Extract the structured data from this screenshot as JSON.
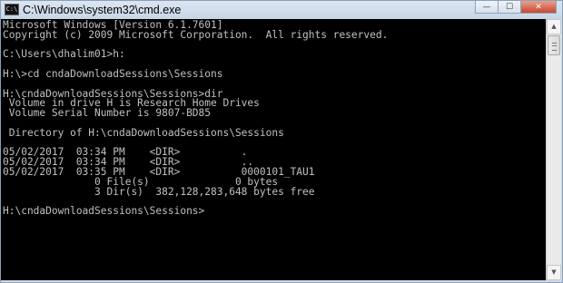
{
  "window": {
    "title": "C:\\Windows\\system32\\cmd.exe",
    "icon_name": "cmd-icon",
    "minimize_glyph": "—",
    "maximize_glyph": "☐",
    "close_glyph": "✕"
  },
  "console": {
    "text": "Microsoft Windows [Version 6.1.7601]\nCopyright (c) 2009 Microsoft Corporation.  All rights reserved.\n\nC:\\Users\\dhalim01>h:\n\nH:\\>cd cndaDownloadSessions\\Sessions\n\nH:\\cndaDownloadSessions\\Sessions>dir\n Volume in drive H is Research Home Drives\n Volume Serial Number is 9807-BD85\n\n Directory of H:\\cndaDownloadSessions\\Sessions\n\n05/02/2017  03:34 PM    <DIR>          .\n05/02/2017  03:34 PM    <DIR>          ..\n05/02/2017  03:35 PM    <DIR>          0000101_TAU1\n               0 File(s)              0 bytes\n               3 Dir(s)  382,128,283,648 bytes free\n\nH:\\cndaDownloadSessions\\Sessions>"
  },
  "scrollbar": {
    "up_glyph": "▲",
    "down_glyph": "▼"
  }
}
